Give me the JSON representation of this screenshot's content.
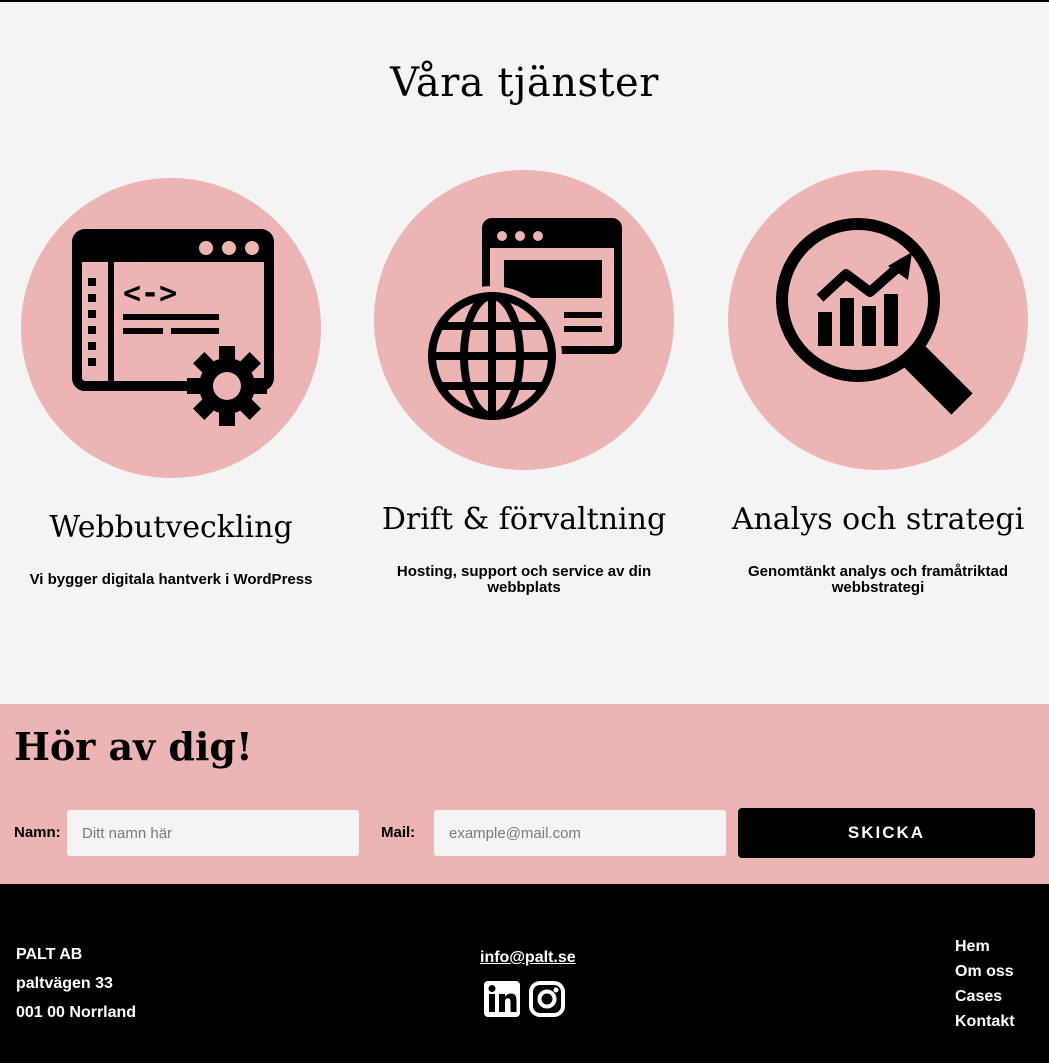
{
  "services": {
    "title": "Våra tjänster",
    "items": [
      {
        "title": "Webbutveckling",
        "description": "Vi bygger digitala hantverk i WordPress",
        "icon": "web-development-icon"
      },
      {
        "title": "Drift & förvaltning",
        "description": "Hosting, support och service av din webbplats",
        "icon": "globe-browser-icon"
      },
      {
        "title": "Analys och strategi",
        "description": "Genomtänkt analys och framåtriktad webbstrategi",
        "icon": "analytics-magnifier-icon"
      }
    ]
  },
  "contact": {
    "title": "Hör av dig!",
    "name_label": "Namn:",
    "name_placeholder": "Ditt namn här",
    "mail_label": "Mail:",
    "mail_placeholder": "example@mail.com",
    "submit_label": "SKICKA"
  },
  "footer": {
    "company": "PALT AB",
    "street": "paltvägen 33",
    "postal": "001 00 Norrland",
    "email": "info@palt.se",
    "social": [
      "linkedin-icon",
      "instagram-icon"
    ],
    "nav": [
      "Hem",
      "Om oss",
      "Cases",
      "Kontakt"
    ]
  },
  "colors": {
    "background": "#f4f4f4",
    "accent_pink": "#ecb4b3",
    "footer": "#000000"
  }
}
